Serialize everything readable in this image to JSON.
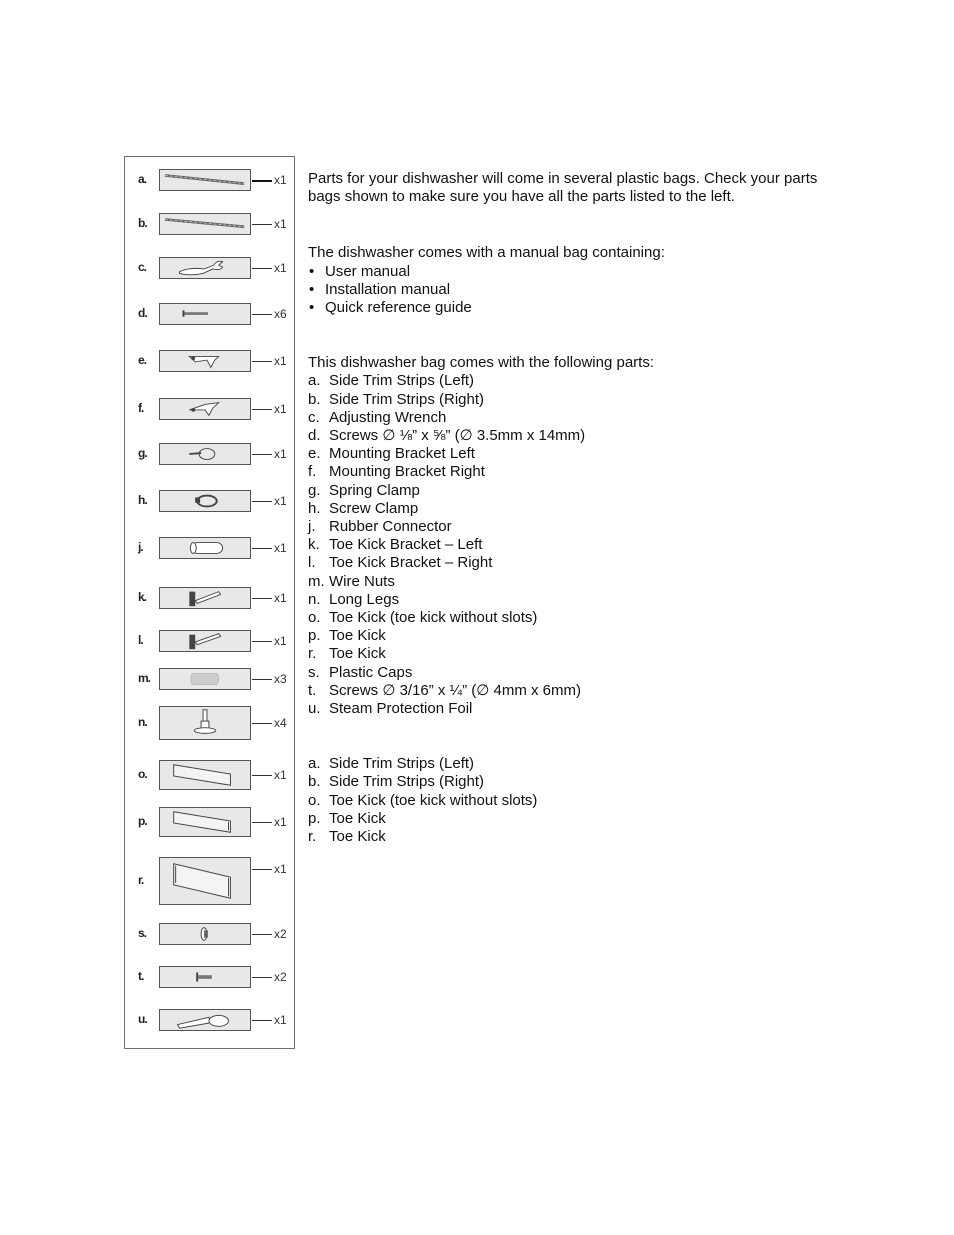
{
  "parts_panel": {
    "parts": [
      {
        "letter": "a.",
        "qty": "x1",
        "icon": "trim-strip-left-icon"
      },
      {
        "letter": "b.",
        "qty": "x1",
        "icon": "trim-strip-right-icon"
      },
      {
        "letter": "c.",
        "qty": "x1",
        "icon": "wrench-icon"
      },
      {
        "letter": "d.",
        "qty": "x6",
        "icon": "screw-icon"
      },
      {
        "letter": "e.",
        "qty": "x1",
        "icon": "mounting-bracket-left-icon"
      },
      {
        "letter": "f.",
        "qty": "x1",
        "icon": "mounting-bracket-right-icon"
      },
      {
        "letter": "g.",
        "qty": "x1",
        "icon": "spring-clamp-icon"
      },
      {
        "letter": "h.",
        "qty": "x1",
        "icon": "screw-clamp-icon"
      },
      {
        "letter": "j.",
        "qty": "x1",
        "icon": "rubber-connector-icon"
      },
      {
        "letter": "k.",
        "qty": "x1",
        "icon": "toe-kick-bracket-left-icon"
      },
      {
        "letter": "l.",
        "qty": "x1",
        "icon": "toe-kick-bracket-right-icon"
      },
      {
        "letter": "m.",
        "qty": "x3",
        "icon": "wire-nut-icon"
      },
      {
        "letter": "n.",
        "qty": "x4",
        "icon": "long-leg-icon"
      },
      {
        "letter": "o.",
        "qty": "x1",
        "icon": "toe-kick-no-slots-icon"
      },
      {
        "letter": "p.",
        "qty": "x1",
        "icon": "toe-kick-icon"
      },
      {
        "letter": "r.",
        "qty": "x1",
        "icon": "toe-kick-large-icon"
      },
      {
        "letter": "s.",
        "qty": "x2",
        "icon": "plastic-cap-icon"
      },
      {
        "letter": "t.",
        "qty": "x2",
        "icon": "small-screw-icon"
      },
      {
        "letter": "u.",
        "qty": "x1",
        "icon": "steam-foil-icon"
      }
    ]
  },
  "intro": {
    "text": "Parts for your dishwasher will come in several plastic bags. Check your parts bags shown to make sure you have all the parts listed to the left."
  },
  "manual_bag": {
    "heading": "The dishwasher comes with a manual bag containing:",
    "bullet": "•",
    "items": [
      "User manual",
      "Installation manual",
      "Quick reference guide"
    ]
  },
  "parts_bag": {
    "heading": "This dishwasher bag comes with the following parts:",
    "items": [
      {
        "label": "a.",
        "text": "Side Trim Strips (Left)"
      },
      {
        "label": "b.",
        "text": "Side Trim Strips (Right)"
      },
      {
        "label": "c.",
        "text": "Adjusting Wrench"
      },
      {
        "label": "d.",
        "text": "Screws ∅ ⅛” x ⅝” (∅ 3.5mm x 14mm)"
      },
      {
        "label": "e.",
        "text": "Mounting Bracket Left"
      },
      {
        "label": "f.",
        "text": "Mounting Bracket Right"
      },
      {
        "label": "g.",
        "text": "Spring Clamp"
      },
      {
        "label": "h.",
        "text": "Screw Clamp"
      },
      {
        "label": "j.",
        "text": "Rubber Connector"
      },
      {
        "label": "k.",
        "text": "Toe Kick Bracket – Left"
      },
      {
        "label": "l.",
        "text": "Toe Kick Bracket – Right"
      },
      {
        "label": "m.",
        "text": "Wire Nuts"
      },
      {
        "label": "n.",
        "text": "Long Legs"
      },
      {
        "label": "o.",
        "text": "Toe Kick (toe kick without slots)"
      },
      {
        "label": "p.",
        "text": "Toe Kick"
      },
      {
        "label": "r.",
        "text": "Toe Kick"
      },
      {
        "label": "s.",
        "text": "Plastic Caps"
      },
      {
        "label": "t.",
        "text": "Screws ∅ 3/16” x ¼” (∅ 4mm x 6mm)"
      },
      {
        "label": "u.",
        "text": "Steam Protection Foil"
      }
    ]
  },
  "separate_items": {
    "items": [
      {
        "label": "a.",
        "text": "Side Trim Strips (Left)"
      },
      {
        "label": "b.",
        "text": "Side Trim Strips (Right)"
      },
      {
        "label": "o.",
        "text": "Toe Kick (toe kick without slots)"
      },
      {
        "label": "p.",
        "text": "Toe Kick"
      },
      {
        "label": "r.",
        "text": "Toe Kick"
      }
    ]
  }
}
